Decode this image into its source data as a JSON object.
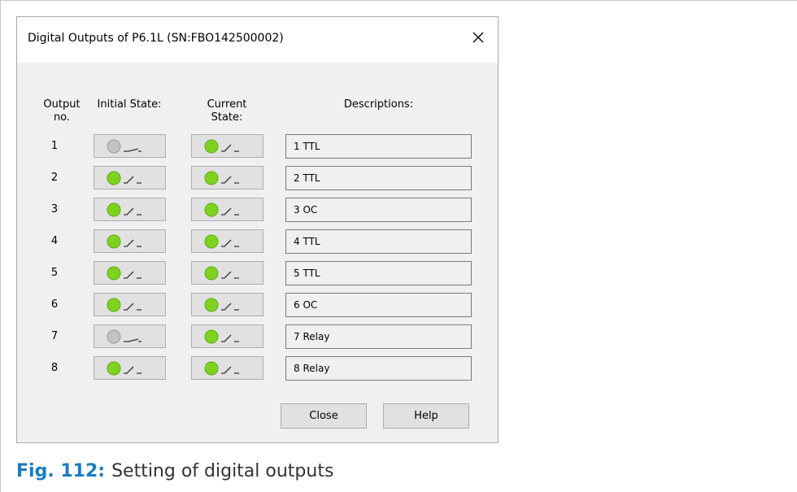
{
  "dialog": {
    "title": "Digital Outputs of P6.1L (SN:FBO142500002)",
    "headers": {
      "output_no": "Output\nno.",
      "initial_state": "Initial State:",
      "current_state": "Current\nState:",
      "descriptions": "Descriptions:"
    },
    "rows": [
      {
        "no": "1",
        "initial": "off",
        "current": "on",
        "description": "1 TTL"
      },
      {
        "no": "2",
        "initial": "on",
        "current": "on",
        "description": "2 TTL"
      },
      {
        "no": "3",
        "initial": "on",
        "current": "on",
        "description": "3 OC"
      },
      {
        "no": "4",
        "initial": "on",
        "current": "on",
        "description": "4 TTL"
      },
      {
        "no": "5",
        "initial": "on",
        "current": "on",
        "description": "5 TTL"
      },
      {
        "no": "6",
        "initial": "on",
        "current": "on",
        "description": "6 OC"
      },
      {
        "no": "7",
        "initial": "off",
        "current": "on",
        "description": "7 Relay"
      },
      {
        "no": "8",
        "initial": "on",
        "current": "on",
        "description": "8 Relay"
      }
    ],
    "buttons": {
      "close_label": "Close",
      "help_label": "Help"
    }
  },
  "caption": {
    "label": "Fig. 112:",
    "text": "Setting of digital outputs"
  },
  "colors": {
    "led_on": "#7fd320",
    "led_off": "#c3c3c3",
    "caption_label": "#1a7cc1"
  },
  "icons": {
    "close": "close-x-icon",
    "switch_on": "switch-closed-icon",
    "switch_off": "switch-open-icon"
  }
}
